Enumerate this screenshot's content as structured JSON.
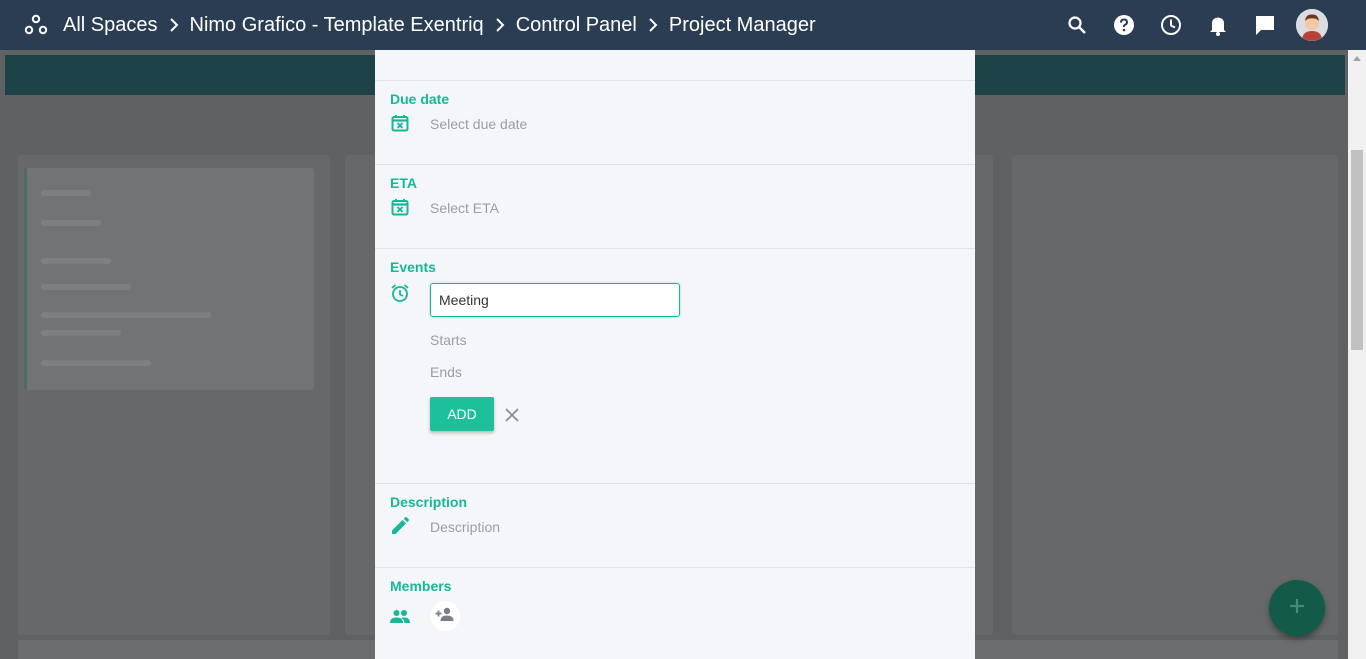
{
  "header": {
    "breadcrumbs": [
      "All Spaces",
      "Nimo Grafico - Template Exentriq",
      "Control Panel",
      "Project Manager"
    ],
    "icons": [
      "spaces-icon",
      "search-icon",
      "help-icon",
      "clock-icon",
      "bell-icon",
      "chat-icon",
      "avatar"
    ]
  },
  "panel": {
    "due_date": {
      "label": "Due date",
      "placeholder": "Select due date",
      "icon": "calendar-icon"
    },
    "eta": {
      "label": "ETA",
      "placeholder": "Select ETA",
      "icon": "calendar-icon"
    },
    "events": {
      "label": "Events",
      "icon": "alarm-icon",
      "input_value": "Meeting",
      "starts_placeholder": "Starts",
      "ends_placeholder": "Ends",
      "add_label": "ADD"
    },
    "description": {
      "label": "Description",
      "placeholder": "Description",
      "icon": "pencil-icon"
    },
    "members": {
      "label": "Members",
      "icon": "people-icon",
      "add_icon": "add-person-icon"
    }
  },
  "colors": {
    "accent": "#15b897",
    "topbar": "#2b3d52",
    "panel_bg": "#f5f6f9",
    "add_button": "#1cc09b",
    "fab": "#135a48"
  },
  "fab": {
    "icon": "plus-icon"
  }
}
